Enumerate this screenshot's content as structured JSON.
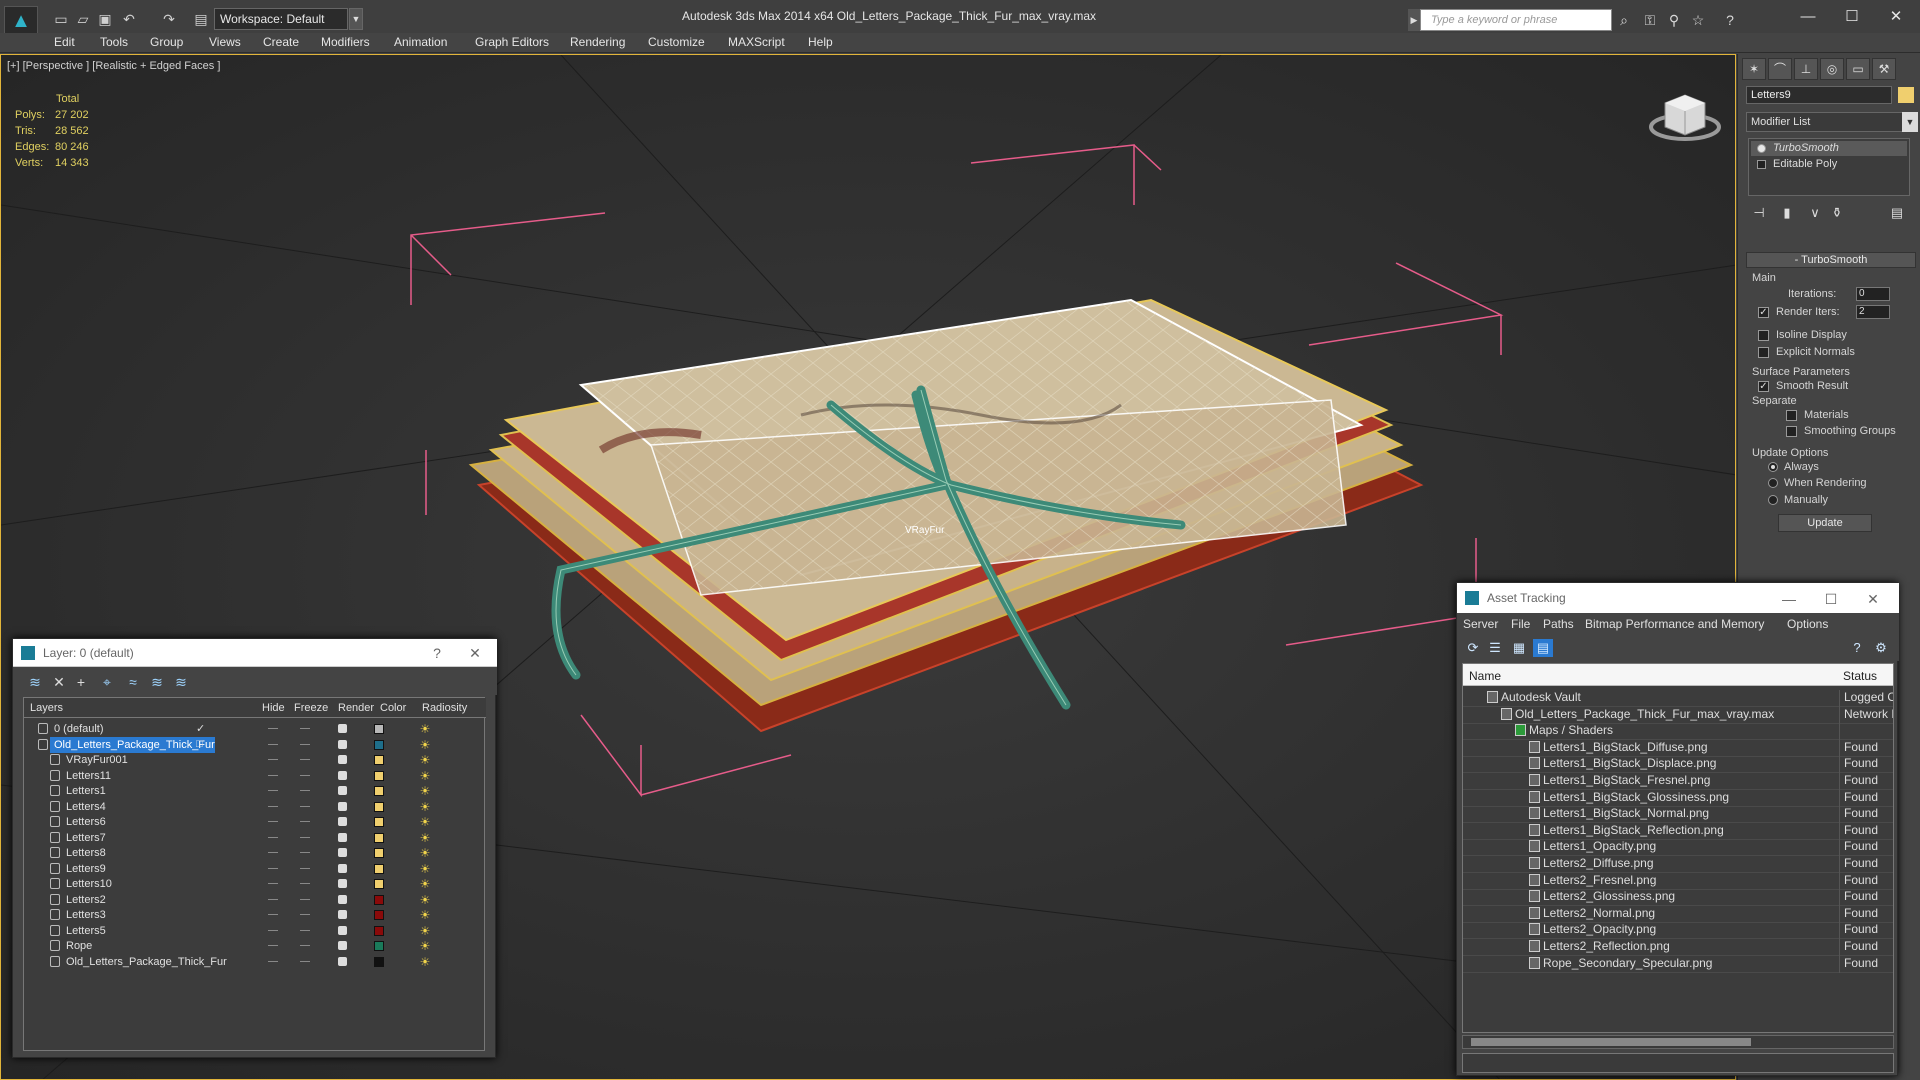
{
  "titlebar": {
    "workspace": "Workspace: Default",
    "app_title": "Autodesk 3ds Max  2014 x64     Old_Letters_Package_Thick_Fur_max_vray.max",
    "search_placeholder": "Type a keyword or phrase"
  },
  "menubar": [
    "Edit",
    "Tools",
    "Group",
    "Views",
    "Create",
    "Modifiers",
    "Animation",
    "Graph Editors",
    "Rendering",
    "Customize",
    "MAXScript",
    "Help"
  ],
  "viewport": {
    "label": "[+] [Perspective ] [Realistic + Edged Faces ]",
    "stats_header": "Total",
    "stats": [
      {
        "label": "Polys:",
        "value": "27 202"
      },
      {
        "label": "Tris:",
        "value": "28 562"
      },
      {
        "label": "Edges:",
        "value": "80 246"
      },
      {
        "label": "Verts:",
        "value": "14 343"
      }
    ],
    "object_label": "VRayFur"
  },
  "command_panel": {
    "object_name": "Letters9",
    "object_color": "#f0cf6e",
    "modifier_list": "Modifier List",
    "stack": [
      "TurboSmooth",
      "Editable Poly"
    ],
    "rollout_title": "TurboSmooth",
    "main_group": "Main",
    "iterations_label": "Iterations:",
    "iterations_value": "0",
    "render_iters_label": "Render Iters:",
    "render_iters_value": "2",
    "isoline": "Isoline Display",
    "explicit_normals": "Explicit Normals",
    "surface_group": "Surface Parameters",
    "smooth_result": "Smooth Result",
    "separate": "Separate",
    "materials": "Materials",
    "smoothing_groups": "Smoothing Groups",
    "update_group": "Update Options",
    "always": "Always",
    "when_rendering": "When Rendering",
    "manually": "Manually",
    "update_button": "Update"
  },
  "layer_window": {
    "title": "Layer: 0 (default)",
    "help": "?",
    "close": "✕",
    "columns": [
      "Layers",
      "Hide",
      "Freeze",
      "Render",
      "Color",
      "Radiosity"
    ],
    "rows": [
      {
        "name": "0 (default)",
        "color": "#b8b8b8",
        "indent": 1,
        "selected": false
      },
      {
        "name": "Old_Letters_Package_Thick_Fur",
        "color": "#1e6e8a",
        "indent": 1,
        "selected": true
      },
      {
        "name": "VRayFur001",
        "color": "#f0cf6e",
        "indent": 2,
        "selected": false
      },
      {
        "name": "Letters11",
        "color": "#f0cf6e",
        "indent": 2,
        "selected": false
      },
      {
        "name": "Letters1",
        "color": "#f0cf6e",
        "indent": 2,
        "selected": false
      },
      {
        "name": "Letters4",
        "color": "#f0cf6e",
        "indent": 2,
        "selected": false
      },
      {
        "name": "Letters6",
        "color": "#f0cf6e",
        "indent": 2,
        "selected": false
      },
      {
        "name": "Letters7",
        "color": "#f0cf6e",
        "indent": 2,
        "selected": false
      },
      {
        "name": "Letters8",
        "color": "#f0cf6e",
        "indent": 2,
        "selected": false
      },
      {
        "name": "Letters9",
        "color": "#f0cf6e",
        "indent": 2,
        "selected": false
      },
      {
        "name": "Letters10",
        "color": "#f0cf6e",
        "indent": 2,
        "selected": false
      },
      {
        "name": "Letters2",
        "color": "#8a0a0a",
        "indent": 2,
        "selected": false
      },
      {
        "name": "Letters3",
        "color": "#8a0a0a",
        "indent": 2,
        "selected": false
      },
      {
        "name": "Letters5",
        "color": "#8a0a0a",
        "indent": 2,
        "selected": false
      },
      {
        "name": "Rope",
        "color": "#1a7a5a",
        "indent": 2,
        "selected": false
      },
      {
        "name": "Old_Letters_Package_Thick_Fur",
        "color": "#111111",
        "indent": 2,
        "selected": false
      }
    ]
  },
  "asset_window": {
    "title": "Asset Tracking",
    "menu": [
      "Server",
      "File",
      "Paths",
      "Bitmap Performance and Memory",
      "Options"
    ],
    "columns": [
      "Name",
      "Status"
    ],
    "rows": [
      {
        "name": "Autodesk Vault",
        "status": "Logged O",
        "level": 1
      },
      {
        "name": "Old_Letters_Package_Thick_Fur_max_vray.max",
        "status": "Network F",
        "level": 2
      },
      {
        "name": "Maps / Shaders",
        "status": "",
        "level": 3
      },
      {
        "name": "Letters1_BigStack_Diffuse.png",
        "status": "Found",
        "level": 4
      },
      {
        "name": "Letters1_BigStack_Displace.png",
        "status": "Found",
        "level": 4
      },
      {
        "name": "Letters1_BigStack_Fresnel.png",
        "status": "Found",
        "level": 4
      },
      {
        "name": "Letters1_BigStack_Glossiness.png",
        "status": "Found",
        "level": 4
      },
      {
        "name": "Letters1_BigStack_Normal.png",
        "status": "Found",
        "level": 4
      },
      {
        "name": "Letters1_BigStack_Reflection.png",
        "status": "Found",
        "level": 4
      },
      {
        "name": "Letters1_Opacity.png",
        "status": "Found",
        "level": 4
      },
      {
        "name": "Letters2_Diffuse.png",
        "status": "Found",
        "level": 4
      },
      {
        "name": "Letters2_Fresnel.png",
        "status": "Found",
        "level": 4
      },
      {
        "name": "Letters2_Glossiness.png",
        "status": "Found",
        "level": 4
      },
      {
        "name": "Letters2_Normal.png",
        "status": "Found",
        "level": 4
      },
      {
        "name": "Letters2_Opacity.png",
        "status": "Found",
        "level": 4
      },
      {
        "name": "Letters2_Reflection.png",
        "status": "Found",
        "level": 4
      },
      {
        "name": "Rope_Secondary_Specular.png",
        "status": "Found",
        "level": 4
      }
    ]
  }
}
